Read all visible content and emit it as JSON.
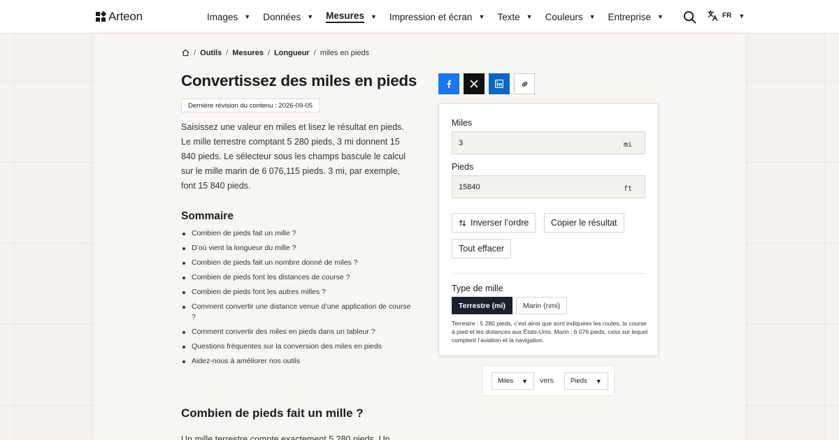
{
  "brand": {
    "name": "Arteon"
  },
  "nav": [
    {
      "label": "Images",
      "active": false
    },
    {
      "label": "Données",
      "active": false
    },
    {
      "label": "Mesures",
      "active": true
    },
    {
      "label": "Impression et écran",
      "active": false
    },
    {
      "label": "Texte",
      "active": false
    },
    {
      "label": "Couleurs",
      "active": false
    },
    {
      "label": "Entreprise",
      "active": false
    }
  ],
  "language": {
    "code": "FR"
  },
  "breadcrumb": {
    "items": [
      "Outils",
      "Mesures",
      "Longueur"
    ],
    "current": "miles en pieds"
  },
  "page": {
    "title": "Convertissez des miles en pieds",
    "revision": "Dernière révision du contenu : 2026-09-05",
    "intro": "Saisissez une valeur en miles et lisez le résultat en pieds. Le mille terrestre comptant 5 280 pieds, 3 mi donnent 15 840 pieds. Le sélecteur sous les champs bascule le calcul sur le mille marin de 6 076,115 pieds. 3 mi, par exemple, font 15 840 pieds."
  },
  "toc": {
    "title": "Sommaire",
    "items": [
      "Combien de pieds fait un mille ?",
      "D’où vient la longueur du mille ?",
      "Combien de pieds fait un nombre donné de miles ?",
      "Combien de pieds font les distances de course ?",
      "Combien de pieds font les autres milles ?",
      "Comment convertir une distance venue d’une application de course ?",
      "Comment convertir des miles en pieds dans un tableur ?",
      "Questions fréquentes sur la conversion des miles en pieds",
      "Aidez-nous à améliorer nos outils"
    ]
  },
  "section": {
    "heading": "Combien de pieds fait un mille ?",
    "text": "Un mille terrestre compte exactement 5 280 pieds. Un"
  },
  "converter": {
    "from": {
      "label": "Miles",
      "value": "3",
      "unit": "mi"
    },
    "to": {
      "label": "Pieds",
      "value": "15840",
      "unit": "ft"
    },
    "swap_label": "Inverser l’ordre",
    "copy_label": "Copier le résultat",
    "clear_label": "Tout effacer",
    "mile_type": {
      "label": "Type de mille",
      "options": [
        "Terrestre (mi)",
        "Marin (nmi)"
      ],
      "selected": "Terrestre (mi)",
      "note": "Terrestre : 5 280 pieds, c’est ainsi que sont indiquées les routes, la course à pied et les distances aux États-Unis. Marin : 6 076 pieds, celui sur lequel comptent l’aviation et la navigation."
    }
  },
  "unit_selector": {
    "from": "Miles",
    "connector": "vers",
    "to": "Pieds"
  },
  "colors": {
    "background": "#f6f3ef",
    "facebook": "#1877f2",
    "x": "#111111",
    "linkedin": "#0a66c2",
    "active_segment": "#1d1f2b"
  }
}
